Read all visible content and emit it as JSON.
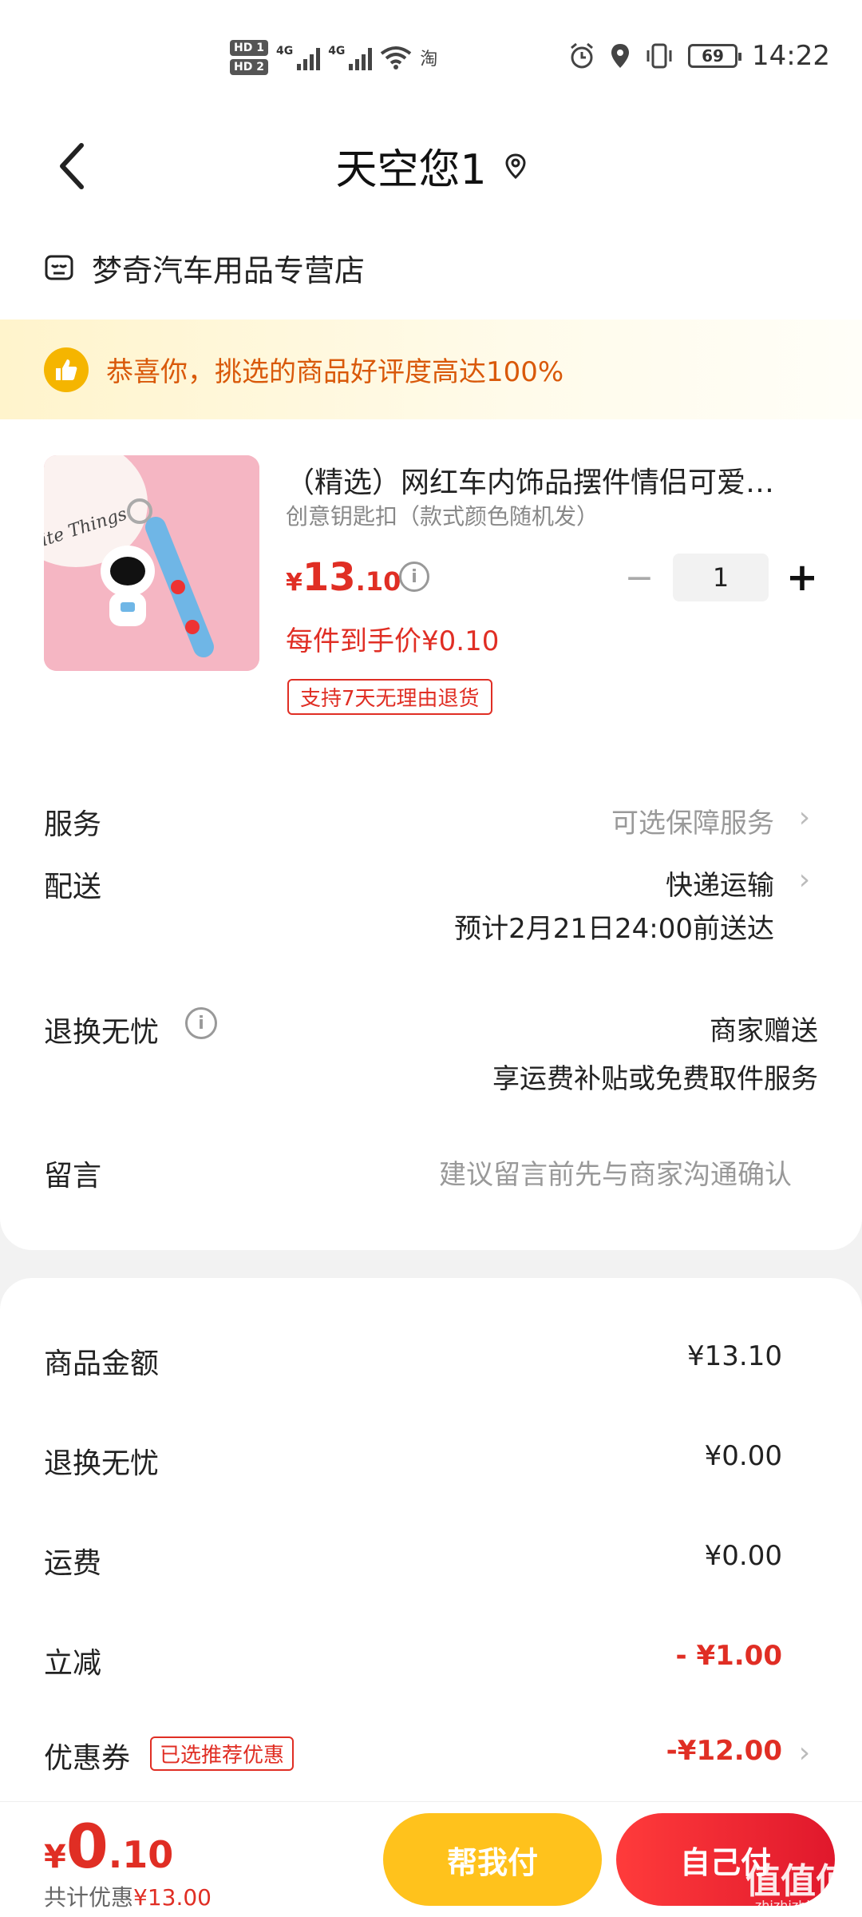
{
  "status_bar": {
    "hd1": "HD 1",
    "hd2": "HD 2",
    "net1": "4G",
    "net2": "4G",
    "app_icon": "淘",
    "battery": "69",
    "time": "14:22"
  },
  "nav": {
    "title": "天空您1"
  },
  "store": {
    "name": "梦奇汽车用品专营店"
  },
  "banner": {
    "text": "恭喜你，挑选的商品好评度高达100%"
  },
  "product": {
    "title": "（精选）网红车内饰品摆件情侣可爱…",
    "spec": "创意钥匙扣（款式颜色随机发）",
    "price_currency": "¥",
    "price_int": "13",
    "price_dec": ".10",
    "quantity": "1",
    "per_item_price": "每件到手价¥0.10",
    "return_tag": "支持7天无理由退货",
    "thumb_text": "ite Things"
  },
  "rows": {
    "service_label": "服务",
    "service_value": "可选保障服务",
    "delivery_label": "配送",
    "delivery_value": "快递运输",
    "delivery_eta": "预计2月21日24:00前送达",
    "returns_label": "退换无忧",
    "returns_value": "商家赠送",
    "returns_detail": "享运费补贴或免费取件服务",
    "message_label": "留言",
    "message_placeholder": "建议留言前先与商家沟通确认"
  },
  "summary": {
    "goods_label": "商品金额",
    "goods_value": "¥13.10",
    "returns_label": "退换无忧",
    "returns_value": "¥0.00",
    "shipping_label": "运费",
    "shipping_value": "¥0.00",
    "discount_label": "立减",
    "discount_value": "- ¥1.00",
    "coupon_label": "优惠券",
    "coupon_tag": "已选推荐优惠",
    "coupon_value": "-¥12.00"
  },
  "footer": {
    "total_currency": "¥",
    "total_int": "0",
    "total_dec": ".10",
    "saved_prefix": "共计优惠",
    "saved_value": "¥13.00",
    "help_pay": "帮我付",
    "self_pay": "自己付",
    "watermark": "值值值",
    "watermark_sub": "zhizhizhi.com"
  },
  "colors": {
    "accent_red": "#e02e24",
    "help_yellow": "#ffc21c",
    "banner_orange": "#d9590a"
  }
}
